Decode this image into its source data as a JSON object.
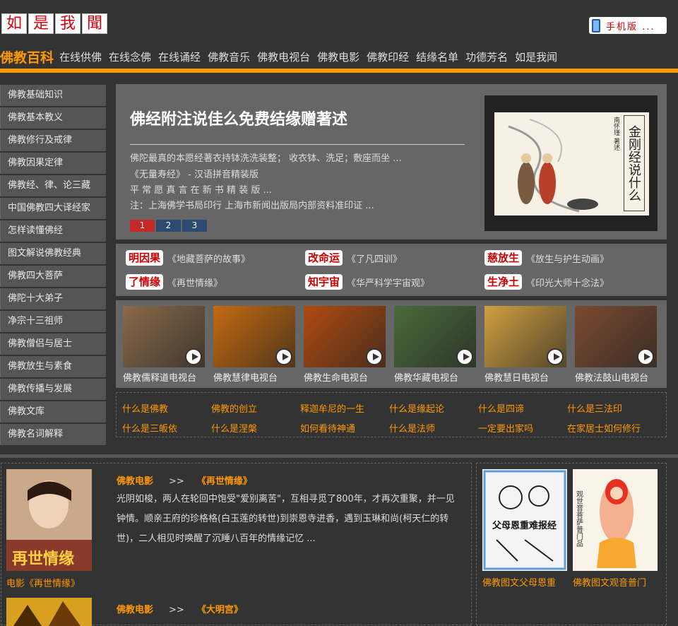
{
  "header": {
    "logo_chars": [
      "如",
      "是",
      "我",
      "聞"
    ],
    "mobile_label": "手机版 ..."
  },
  "nav": {
    "brand": "佛教百科",
    "items": [
      "在线供佛",
      "在线念佛",
      "在线诵经",
      "佛教音乐",
      "佛教电视台",
      "佛教电影",
      "佛教印经",
      "结缘名单",
      "功德芳名",
      "如是我闻"
    ]
  },
  "sidebar": {
    "items": [
      "佛教基础知识",
      "佛教基本教义",
      "佛教修行及戒律",
      "佛教因果定律",
      "佛教经、律、论三藏",
      "中国佛教四大译经家",
      "怎样读懂佛经",
      "图文解说佛教经典",
      "佛教四大菩萨",
      "佛陀十大弟子",
      "净宗十三祖师",
      "佛教僧侣与居士",
      "佛教放生与素食",
      "佛教传播与发展",
      "佛教文库",
      "佛教名词解释"
    ]
  },
  "slider": {
    "title": "佛经附注说佳么免费结缘赠著述",
    "desc_lines": [
      "佛陀最真的本愿经著衣持钵洗洗装整； 收衣钵、洗足；敷座而坐 ...",
      "《无量寿经》 - 汉语拼音精装版",
      "平 常 愿 真 言 在 新 书 精 装 版 ...",
      "注：上海佛学书局印行 上海市新闻出版局内部资料准印证 ..."
    ],
    "pages": [
      "1",
      "2",
      "3"
    ],
    "active_page": 0,
    "book_title": "金刚经说什么",
    "book_author": "南怀瑾 著述"
  },
  "tags": [
    {
      "chip": "明因果",
      "sub": "《地藏菩萨的故事》"
    },
    {
      "chip": "改命运",
      "sub": "《了凡四训》"
    },
    {
      "chip": "慈放生",
      "sub": "《放生与护生动画》"
    },
    {
      "chip": "了情缘",
      "sub": "《再世情缘》"
    },
    {
      "chip": "知宇宙",
      "sub": "《华严科学宇宙观》"
    },
    {
      "chip": "生净土",
      "sub": "《印光大师十念法》"
    }
  ],
  "tv": [
    {
      "label": "佛教儒释道电视台",
      "bg": "#8a6a4a"
    },
    {
      "label": "佛教慧律电视台",
      "bg": "#c46a10"
    },
    {
      "label": "佛教生命电视台",
      "bg": "#b04a10"
    },
    {
      "label": "佛教华藏电视台",
      "bg": "#4a6a3a"
    },
    {
      "label": "佛教慧日电视台",
      "bg": "#d0a040"
    },
    {
      "label": "佛教法鼓山电视台",
      "bg": "#7a4a30"
    }
  ],
  "links": [
    "什么是佛教",
    "佛教的创立",
    "释迦牟尼的一生",
    "什么是缘起论",
    "什么是四谛",
    "什么是三法印",
    "什么是三皈依",
    "什么是涅槃",
    "如何看待神通",
    "什么是法师",
    "一定要出家吗",
    "在家居士如何修行"
  ],
  "movies": [
    {
      "category": "佛教电影",
      "arrow": ">>",
      "title": "《再世情缘》",
      "desc": "光阴如梭，两人在轮回中饱受\"爱别离苦\"，互相寻觅了800年，才再次重聚，并一见钟情。顺亲王府的珍格格(白玉莲的转世)到崇恩寺进香，遇到玉琳和尚(柯天仁的转世)，二人相见时唤醒了沉睡八百年的情缘记忆 ...",
      "caption": "电影《再世情缘》",
      "poster_text": "再世情缘"
    },
    {
      "category": "佛教电影",
      "arrow": ">>",
      "title": "《大明宫》"
    }
  ],
  "image_items": [
    {
      "caption": "佛教图文父母恩重",
      "poster_text": "父母恩重难报经"
    },
    {
      "caption": "佛教图文观音普门",
      "poster_text": "观世音菩萨普门品"
    }
  ]
}
